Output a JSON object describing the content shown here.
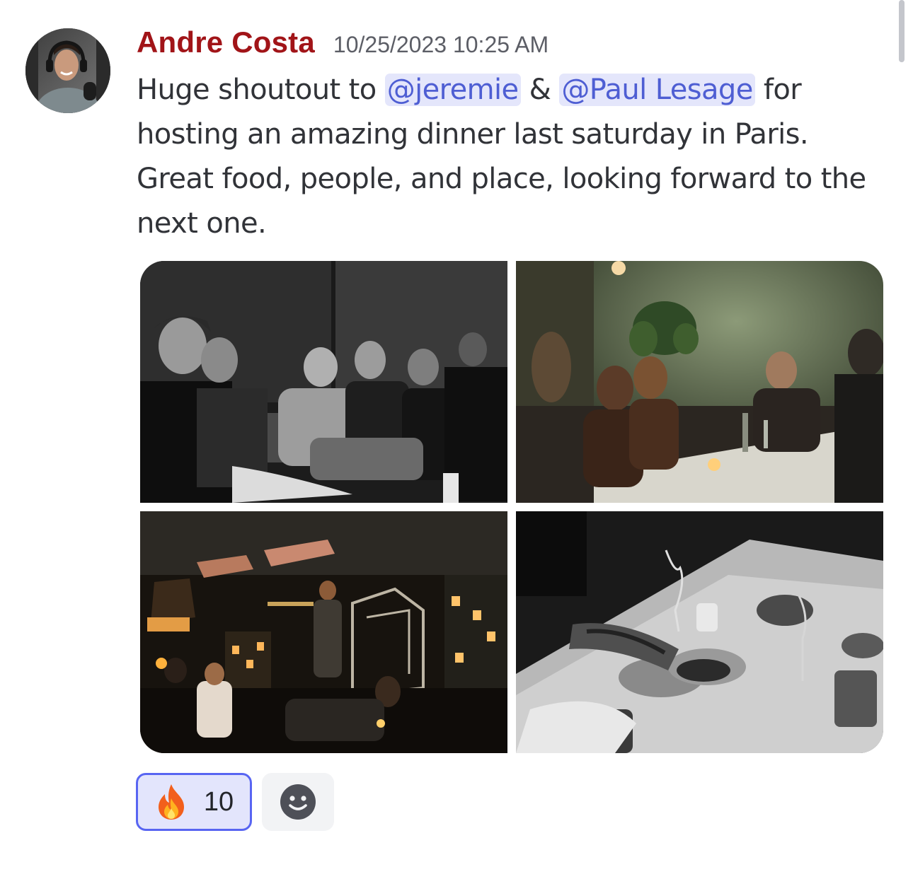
{
  "message": {
    "author": "Andre Costa",
    "timestamp": "10/25/2023 10:25 AM",
    "author_color": "#a11418",
    "text_parts": {
      "before": "Huge shoutout to ",
      "mention_1": "@jeremie",
      "between": " & ",
      "mention_2": "@Paul Lesage",
      "after": " for hosting an amazing dinner last saturday in Paris. Great food, people, and place, looking forward to the next one."
    }
  },
  "attachments": [
    {
      "kind": "photo",
      "tone": "black-and-white"
    },
    {
      "kind": "photo",
      "tone": "warm-color"
    },
    {
      "kind": "photo",
      "tone": "warm-color"
    },
    {
      "kind": "photo",
      "tone": "black-and-white"
    }
  ],
  "reactions": [
    {
      "emoji": "🔥",
      "icon": "fire-icon",
      "count": "10",
      "active": true
    }
  ],
  "add_reaction_icon": "smiley-icon",
  "colors": {
    "mention_bg": "#e4e6fb",
    "mention_text": "#4e5ed3",
    "reaction_border": "#5865f2",
    "reaction_bg": "#e3e5fc"
  }
}
